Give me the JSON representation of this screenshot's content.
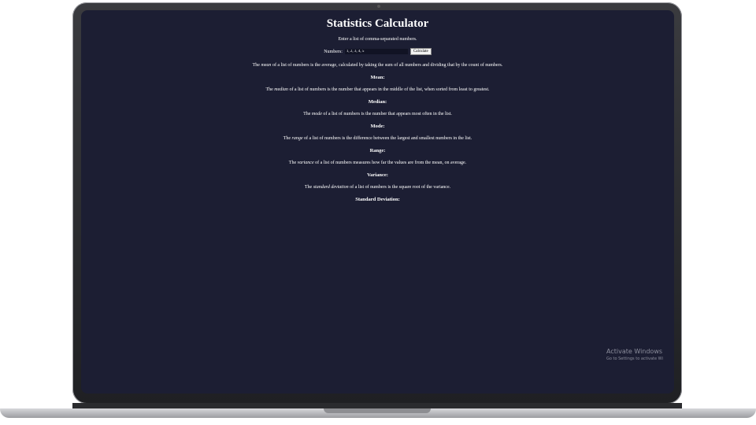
{
  "page": {
    "title": "Statistics Calculator",
    "intro": "Enter a list of comma-separated numbers."
  },
  "form": {
    "label": "Numbers:",
    "input_value": "1, 2, 3, 4, 5",
    "button_label": "Calculate"
  },
  "sections": [
    {
      "prefix": "The ",
      "term": "mean",
      "suffix": " of a list of numbers is the average, calculated by taking the sum of all numbers and dividing that by the count of numbers.",
      "result_label": "Mean:"
    },
    {
      "prefix": "The ",
      "term": "median",
      "suffix": " of a list of numbers is the number that appears in the middle of the list, when sorted from least to greatest.",
      "result_label": "Median:"
    },
    {
      "prefix": "The ",
      "term": "mode",
      "suffix": " of a list of numbers is the number that appears most often in the list.",
      "result_label": "Mode:"
    },
    {
      "prefix": "The ",
      "term": "range",
      "suffix": " of a list of numbers is the difference between the largest and smallest numbers in the list.",
      "result_label": "Range:"
    },
    {
      "prefix": "The ",
      "term": "variance",
      "suffix": " of a list of numbers measures how far the values are from the mean, on average.",
      "result_label": "Variance:"
    },
    {
      "prefix": "The ",
      "term": "standard deviation",
      "suffix": " of a list of numbers is the square root of the variance.",
      "result_label": "Standard Deviation:"
    }
  ],
  "watermark": {
    "title": "Activate Windows",
    "subtitle": "Go to Settings to activate Wi"
  },
  "colors": {
    "screen_bg": "#1c1e33",
    "text": "#ffffff"
  }
}
